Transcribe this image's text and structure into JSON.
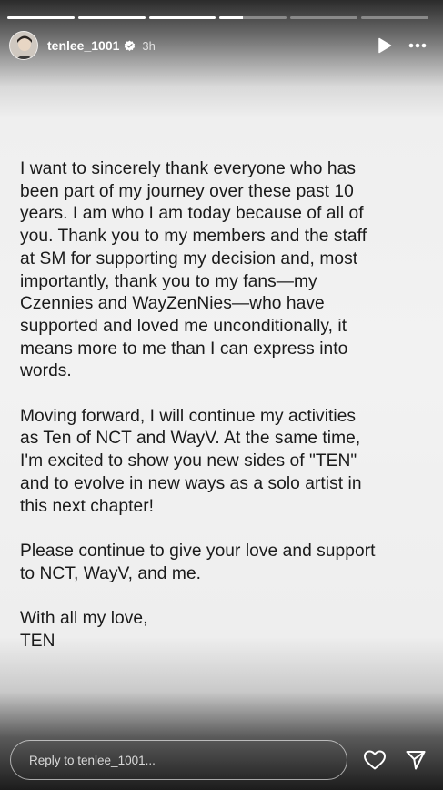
{
  "story": {
    "segments": [
      {
        "progress": 1.0
      },
      {
        "progress": 1.0
      },
      {
        "progress": 1.0
      },
      {
        "progress": 0.35
      },
      {
        "progress": 0.0
      },
      {
        "progress": 0.0
      }
    ]
  },
  "header": {
    "username": "tenlee_1001",
    "time": "3h",
    "verified": true,
    "icons": [
      "play-icon",
      "more-icon"
    ]
  },
  "letter": {
    "p1": "I want to sincerely thank everyone who has\nbeen part of my journey over these past 10\nyears. I am who I am today because of all of\nyou. Thank you to my members and the staff\nat SM for supporting my decision and, most\nimportantly, thank you to my fans—my\nCzennies and WayZenNies—who have\nsupported and loved me unconditionally, it\nmeans more to me than I can express into\nwords.",
    "p2": "Moving forward, I will continue my activities\nas Ten of NCT and WayV. At the same time,\nI'm excited to show you new sides of \"TEN\"\nand to evolve in new ways as a solo artist in\nthis next chapter!",
    "p3": "Please continue to give your love and support\nto NCT, WayV, and me.",
    "p4": "With all my love,\nTEN"
  },
  "reply": {
    "placeholder": "Reply to tenlee_1001...",
    "icons": [
      "heart-icon",
      "send-icon"
    ]
  }
}
